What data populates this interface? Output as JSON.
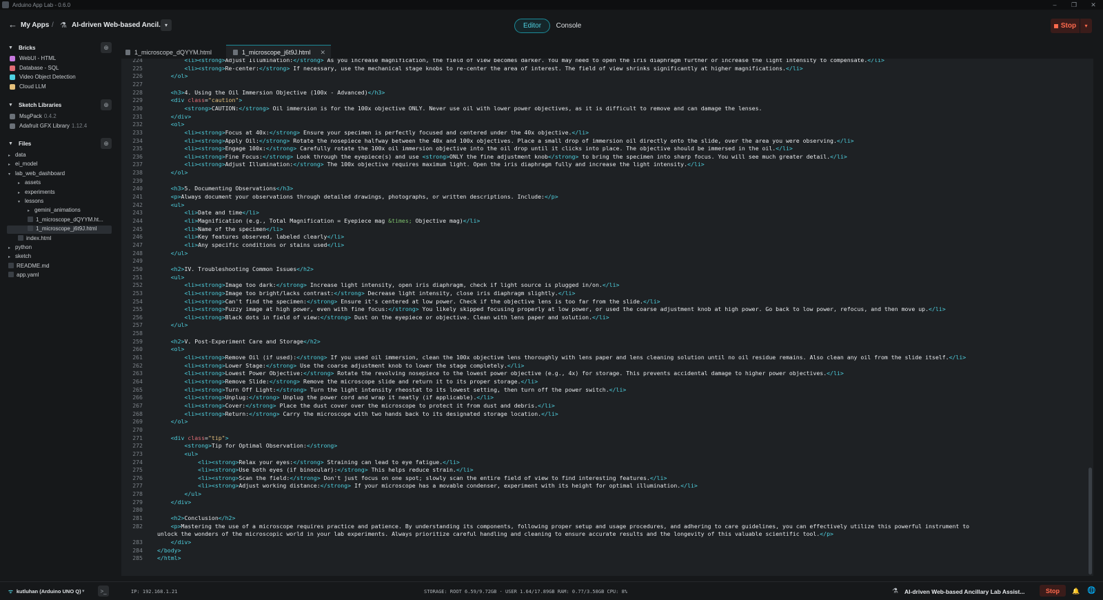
{
  "window": {
    "title": "Arduino App Lab - 0.6.0",
    "min": "–",
    "max": "❐",
    "close": "✕"
  },
  "header": {
    "back": "←",
    "my_apps": "My Apps",
    "sep": "/",
    "app_name": "AI-driven Web-based Ancil...",
    "dd": "▾",
    "modes": {
      "editor": "Editor",
      "console": "Console"
    },
    "stop": "Stop",
    "stop_dd": "▾"
  },
  "sidebar": {
    "bricks": {
      "label": "Bricks",
      "add": "⊕",
      "items": [
        {
          "name": "WebUI - HTML",
          "color": "#c678dd"
        },
        {
          "name": "Database - SQL",
          "color": "#e06c75"
        },
        {
          "name": "Video Object Detection",
          "color": "#4fd1e0"
        },
        {
          "name": "Cloud LLM",
          "color": "#e5c07b"
        }
      ]
    },
    "libraries": {
      "label": "Sketch Libraries",
      "add": "⊕",
      "items": [
        {
          "name": "MsgPack",
          "version": "0.4.2"
        },
        {
          "name": "Adafruit GFX Library",
          "version": "1.12.4"
        }
      ]
    },
    "files": {
      "label": "Files",
      "add": "⊕",
      "tree": [
        {
          "name": "data",
          "caret": "▸"
        },
        {
          "name": "ei_model",
          "caret": "▸"
        },
        {
          "name": "lab_web_dashboard",
          "caret": "▾"
        },
        {
          "name": "assets",
          "caret": "▸"
        },
        {
          "name": "experiments",
          "caret": "▸"
        },
        {
          "name": "lessons",
          "caret": "▾"
        },
        {
          "name": "gemini_animations",
          "caret": "▸"
        },
        {
          "name": "1_microscope_dQYYM.ht...",
          "caret": ""
        },
        {
          "name": "1_microscope_j6t9J.html",
          "caret": ""
        },
        {
          "name": "index.html",
          "caret": ""
        },
        {
          "name": "python",
          "caret": "▸"
        },
        {
          "name": "sketch",
          "caret": "▸"
        },
        {
          "name": "README.md",
          "caret": ""
        },
        {
          "name": "app.yaml",
          "caret": ""
        }
      ]
    }
  },
  "tabs": [
    {
      "label": "1_microscope_dQYYM.html"
    },
    {
      "label": "1_microscope_j6t9J.html",
      "close": "✕"
    }
  ],
  "editor": {
    "lines": [
      {
        "n": "224",
        "t": "        <li><strong>Adjust Illumination:</strong> As you increase magnification, the field of view becomes darker. You may need to open the iris diaphragm further or increase the light intensity to compensate.</li>"
      },
      {
        "n": "225",
        "t": "        <li><strong>Re-center:</strong> If necessary, use the mechanical stage knobs to re-center the area of interest. The field of view shrinks significantly at higher magnifications.</li>"
      },
      {
        "n": "226",
        "t": "    </ol>"
      },
      {
        "n": "227",
        "t": ""
      },
      {
        "n": "228",
        "t": "    <h3>4. Using the Oil Immersion Objective (100x - Advanced)</h3>"
      },
      {
        "n": "229",
        "t": "    <div class=\"caution\">"
      },
      {
        "n": "230",
        "t": "        <strong>CAUTION:</strong> Oil immersion is for the 100x objective ONLY. Never use oil with lower power objectives, as it is difficult to remove and can damage the lenses."
      },
      {
        "n": "231",
        "t": "    </div>"
      },
      {
        "n": "232",
        "t": "    <ol>"
      },
      {
        "n": "233",
        "t": "        <li><strong>Focus at 40x:</strong> Ensure your specimen is perfectly focused and centered under the 40x objective.</li>"
      },
      {
        "n": "234",
        "t": "        <li><strong>Apply Oil:</strong> Rotate the nosepiece halfway between the 40x and 100x objectives. Place a small drop of immersion oil directly onto the slide, over the area you were observing.</li>"
      },
      {
        "n": "235",
        "t": "        <li><strong>Engage 100x:</strong> Carefully rotate the 100x oil immersion objective into the oil drop until it clicks into place. The objective should be immersed in the oil.</li>"
      },
      {
        "n": "236",
        "t": "        <li><strong>Fine Focus:</strong> Look through the eyepiece(s) and use <strong>ONLY the fine adjustment knob</strong> to bring the specimen into sharp focus. You will see much greater detail.</li>"
      },
      {
        "n": "237",
        "t": "        <li><strong>Adjust Illumination:</strong> The 100x objective requires maximum light. Open the iris diaphragm fully and increase the light intensity.</li>"
      },
      {
        "n": "238",
        "t": "    </ol>"
      },
      {
        "n": "239",
        "t": ""
      },
      {
        "n": "240",
        "t": "    <h3>5. Documenting Observations</h3>"
      },
      {
        "n": "241",
        "t": "    <p>Always document your observations through detailed drawings, photographs, or written descriptions. Include:</p>"
      },
      {
        "n": "242",
        "t": "    <ul>"
      },
      {
        "n": "243",
        "t": "        <li>Date and time</li>"
      },
      {
        "n": "244",
        "t": "        <li>Magnification (e.g., Total Magnification = Eyepiece mag &times; Objective mag)</li>"
      },
      {
        "n": "245",
        "t": "        <li>Name of the specimen</li>"
      },
      {
        "n": "246",
        "t": "        <li>Key features observed, labeled clearly</li>"
      },
      {
        "n": "247",
        "t": "        <li>Any specific conditions or stains used</li>"
      },
      {
        "n": "248",
        "t": "    </ul>"
      },
      {
        "n": "249",
        "t": ""
      },
      {
        "n": "250",
        "t": "    <h2>IV. Troubleshooting Common Issues</h2>"
      },
      {
        "n": "251",
        "t": "    <ul>"
      },
      {
        "n": "252",
        "t": "        <li><strong>Image too dark:</strong> Increase light intensity, open iris diaphragm, check if light source is plugged in/on.</li>"
      },
      {
        "n": "253",
        "t": "        <li><strong>Image too bright/lacks contrast:</strong> Decrease light intensity, close iris diaphragm slightly.</li>"
      },
      {
        "n": "254",
        "t": "        <li><strong>Can't find the specimen:</strong> Ensure it's centered at low power. Check if the objective lens is too far from the slide.</li>"
      },
      {
        "n": "255",
        "t": "        <li><strong>Fuzzy image at high power, even with fine focus:</strong> You likely skipped focusing properly at low power, or used the coarse adjustment knob at high power. Go back to low power, refocus, and then move up.</li>"
      },
      {
        "n": "256",
        "t": "        <li><strong>Black dots in field of view:</strong> Dust on the eyepiece or objective. Clean with lens paper and solution.</li>"
      },
      {
        "n": "257",
        "t": "    </ul>"
      },
      {
        "n": "258",
        "t": ""
      },
      {
        "n": "259",
        "t": "    <h2>V. Post-Experiment Care and Storage</h2>"
      },
      {
        "n": "260",
        "t": "    <ol>"
      },
      {
        "n": "261",
        "t": "        <li><strong>Remove Oil (if used):</strong> If you used oil immersion, clean the 100x objective lens thoroughly with lens paper and lens cleaning solution until no oil residue remains. Also clean any oil from the slide itself.</li>"
      },
      {
        "n": "262",
        "t": "        <li><strong>Lower Stage:</strong> Use the coarse adjustment knob to lower the stage completely.</li>"
      },
      {
        "n": "263",
        "t": "        <li><strong>Lowest Power Objective:</strong> Rotate the revolving nosepiece to the lowest power objective (e.g., 4x) for storage. This prevents accidental damage to higher power objectives.</li>"
      },
      {
        "n": "264",
        "t": "        <li><strong>Remove Slide:</strong> Remove the microscope slide and return it to its proper storage.</li>"
      },
      {
        "n": "265",
        "t": "        <li><strong>Turn Off Light:</strong> Turn the light intensity rheostat to its lowest setting, then turn off the power switch.</li>"
      },
      {
        "n": "266",
        "t": "        <li><strong>Unplug:</strong> Unplug the power cord and wrap it neatly (if applicable).</li>"
      },
      {
        "n": "267",
        "t": "        <li><strong>Cover:</strong> Place the dust cover over the microscope to protect it from dust and debris.</li>"
      },
      {
        "n": "268",
        "t": "        <li><strong>Return:</strong> Carry the microscope with two hands back to its designated storage location.</li>"
      },
      {
        "n": "269",
        "t": "    </ol>"
      },
      {
        "n": "270",
        "t": ""
      },
      {
        "n": "271",
        "t": "    <div class=\"tip\">"
      },
      {
        "n": "272",
        "t": "        <strong>Tip for Optimal Observation:</strong>"
      },
      {
        "n": "273",
        "t": "        <ul>"
      },
      {
        "n": "274",
        "t": "            <li><strong>Relax your eyes:</strong> Straining can lead to eye fatigue.</li>"
      },
      {
        "n": "275",
        "t": "            <li><strong>Use both eyes (if binocular):</strong> This helps reduce strain.</li>"
      },
      {
        "n": "276",
        "t": "            <li><strong>Scan the field:</strong> Don't just focus on one spot; slowly scan the entire field of view to find interesting features.</li>"
      },
      {
        "n": "277",
        "t": "            <li><strong>Adjust working distance:</strong> If your microscope has a movable condenser, experiment with its height for optimal illumination.</li>"
      },
      {
        "n": "278",
        "t": "        </ul>"
      },
      {
        "n": "279",
        "t": "    </div>"
      },
      {
        "n": "280",
        "t": ""
      },
      {
        "n": "281",
        "t": "    <h2>Conclusion</h2>"
      },
      {
        "n": "282",
        "t": "    <p>Mastering the use of a microscope requires practice and patience. By understanding its components, following proper setup and usage procedures, and adhering to care guidelines, you can effectively utilize this powerful instrument to"
      },
      {
        "n": "",
        "t": "unlock the wonders of the microscopic world in your lab experiments. Always prioritize careful handling and cleaning to ensure accurate results and the longevity of this valuable scientific tool.</p>"
      },
      {
        "n": "283",
        "t": "    </div>"
      },
      {
        "n": "284",
        "t": "</body>"
      },
      {
        "n": "285",
        "t": "</html>"
      }
    ]
  },
  "statusbar": {
    "wifi": "ᯤ",
    "board": "kutluhan (Arduino UNO Q)",
    "board_dd": "▾",
    "terminal": ">_",
    "ip": "IP: 192.168.1.21",
    "stats": "STORAGE: ROOT 6.59/9.72GB · USER 1.64/17.89GB   RAM: 0.77/3.58GB   CPU: 8%",
    "app_name": "AI-driven Web-based Ancillary Lab Assist...",
    "stop": "Stop",
    "bell": "🔔",
    "globe": "🌐"
  },
  "colors": {
    "accent": "#1c8c9a",
    "stop": "#ff6a4d",
    "tag": "#4fd1e0",
    "attr": "#e5c07b",
    "entity": "#7ec16e"
  }
}
